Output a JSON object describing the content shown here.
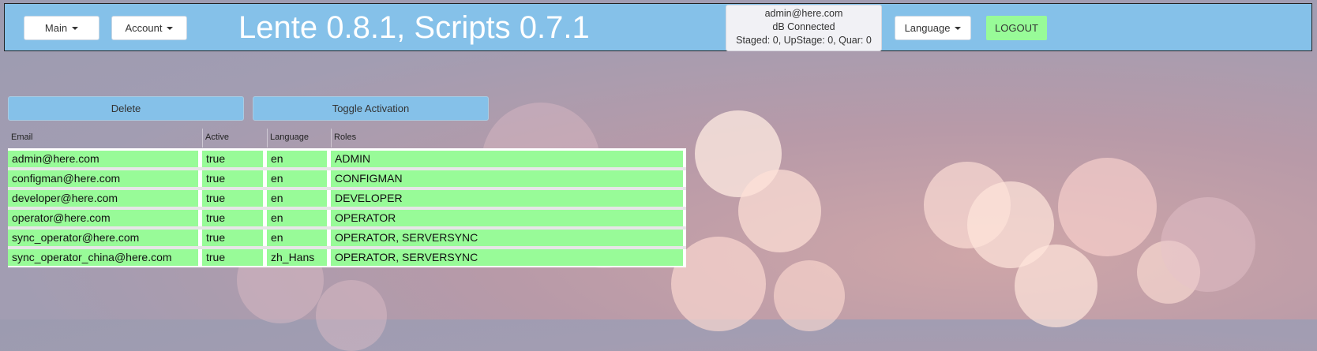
{
  "nav": {
    "main_label": "Main",
    "account_label": "Account",
    "title": "Lente 0.8.1, Scripts 0.7.1",
    "status": {
      "user": "admin@here.com",
      "db": "dB Connected",
      "counts": "Staged: 0, UpStage: 0, Quar: 0"
    },
    "language_label": "Language",
    "logout_label": "LOGOUT"
  },
  "actions": {
    "delete_label": "Delete",
    "toggle_label": "Toggle Activation"
  },
  "table": {
    "headers": [
      "Email",
      "Active",
      "Language",
      "Roles"
    ],
    "rows": [
      [
        "admin@here.com",
        "true",
        "en",
        "ADMIN"
      ],
      [
        "configman@here.com",
        "true",
        "en",
        "CONFIGMAN"
      ],
      [
        "developer@here.com",
        "true",
        "en",
        "DEVELOPER"
      ],
      [
        "operator@here.com",
        "true",
        "en",
        "OPERATOR"
      ],
      [
        "sync_operator@here.com",
        "true",
        "en",
        "OPERATOR, SERVERSYNC"
      ],
      [
        "sync_operator_china@here.com",
        "true",
        "zh_Hans",
        "OPERATOR, SERVERSYNC"
      ]
    ]
  },
  "colors": {
    "navbar": "#85c1e9",
    "cell_green": "#98fb98",
    "logout_green": "#98fb98"
  }
}
